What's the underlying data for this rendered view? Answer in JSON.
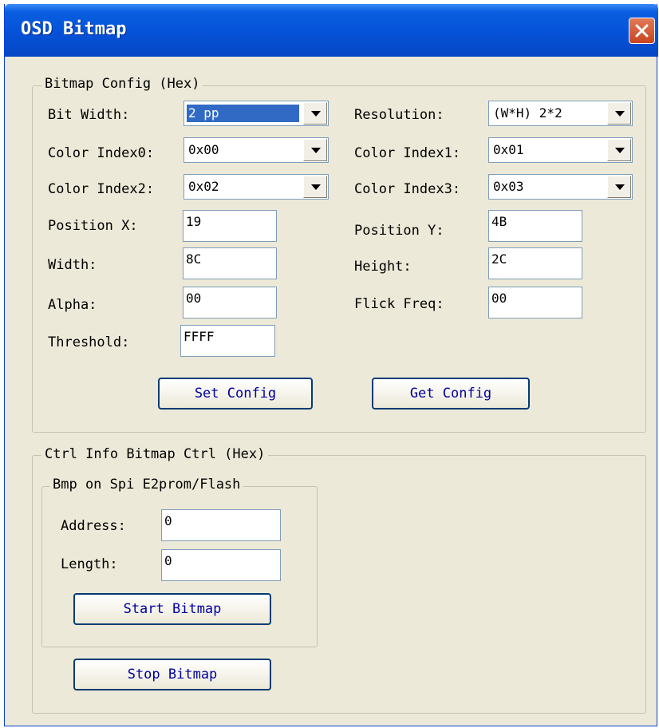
{
  "window": {
    "title": "OSD Bitmap"
  },
  "bitmap_config": {
    "group_label": "Bitmap Config (Hex)",
    "bit_width": {
      "label": "Bit Width:",
      "value": "2 pp"
    },
    "resolution": {
      "label": "Resolution:",
      "value": "(W*H) 2*2"
    },
    "color_index0": {
      "label": "Color Index0:",
      "value": "0x00"
    },
    "color_index1": {
      "label": "Color Index1:",
      "value": "0x01"
    },
    "color_index2": {
      "label": "Color Index2:",
      "value": "0x02"
    },
    "color_index3": {
      "label": "Color Index3:",
      "value": "0x03"
    },
    "position_x": {
      "label": "Position X:",
      "value": "19"
    },
    "position_y": {
      "label": "Position Y:",
      "value": "4B"
    },
    "width": {
      "label": "Width:",
      "value": "8C"
    },
    "height": {
      "label": "Height:",
      "value": "2C"
    },
    "alpha": {
      "label": "Alpha:",
      "value": "00"
    },
    "flick_freq": {
      "label": "Flick Freq:",
      "value": "00"
    },
    "threshold": {
      "label": "Threshold:",
      "value": "FFFF"
    },
    "set_config": "Set Config",
    "get_config": "Get Config"
  },
  "ctrl_info": {
    "group_label": "Ctrl Info Bitmap Ctrl (Hex)",
    "spi_group_label": "Bmp on Spi E2prom/Flash",
    "address": {
      "label": "Address:",
      "value": "0"
    },
    "length": {
      "label": "Length:",
      "value": "0"
    },
    "start_bitmap": "Start Bitmap",
    "stop_bitmap": "Stop Bitmap"
  },
  "colors": {
    "title_bar": "#0552d8",
    "dialog_bg": "#ece9d8",
    "close_button": "#d85a34",
    "selection": "#316ac5"
  },
  "icons": {
    "close": "close-icon",
    "dropdown": "chevron-down-icon"
  }
}
